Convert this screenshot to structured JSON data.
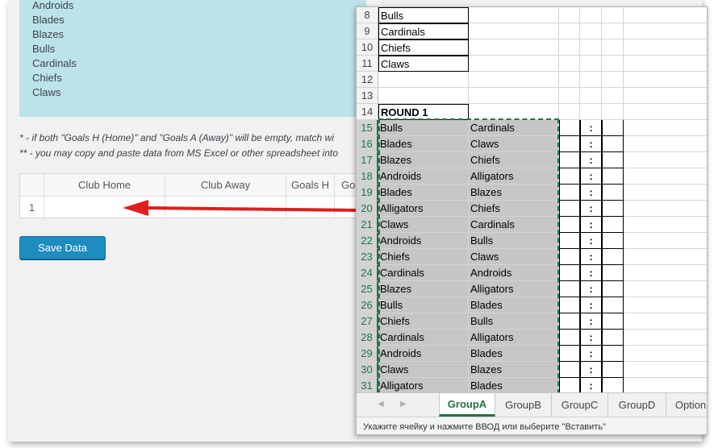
{
  "web_form": {
    "clubs": [
      "Androids",
      "Blades",
      "Blazes",
      "Bulls",
      "Cardinals",
      "Chiefs",
      "Claws"
    ],
    "notes": [
      "* - if both \"Goals H (Home)\" and \"Goals A (Away)\" will be empty, match wi",
      "** - you may copy and paste data from MS Excel or other spreadsheet into"
    ],
    "grid": {
      "headers": [
        "Club Home",
        "Club Away",
        "Goals H",
        "Goa"
      ],
      "row_numbers": [
        "1"
      ]
    },
    "save_label": "Save Data"
  },
  "spreadsheet": {
    "rows": [
      {
        "num": "8",
        "a": "Bulls",
        "b": ""
      },
      {
        "num": "9",
        "a": "Cardinals",
        "b": ""
      },
      {
        "num": "10",
        "a": "Chiefs",
        "b": ""
      },
      {
        "num": "11",
        "a": "Claws",
        "b": ""
      },
      {
        "num": "12",
        "a": "",
        "b": ""
      },
      {
        "num": "13",
        "a": "",
        "b": ""
      },
      {
        "num": "14",
        "a": "ROUND 1",
        "b": ""
      },
      {
        "num": "15",
        "a": "Bulls",
        "b": "Cardinals"
      },
      {
        "num": "16",
        "a": "Blades",
        "b": "Claws"
      },
      {
        "num": "17",
        "a": "Blazes",
        "b": "Chiefs"
      },
      {
        "num": "18",
        "a": "Androids",
        "b": "Alligators"
      },
      {
        "num": "19",
        "a": "Blades",
        "b": "Blazes"
      },
      {
        "num": "20",
        "a": "Alligators",
        "b": "Chiefs"
      },
      {
        "num": "21",
        "a": "Claws",
        "b": "Cardinals"
      },
      {
        "num": "22",
        "a": "Androids",
        "b": "Bulls"
      },
      {
        "num": "23",
        "a": "Chiefs",
        "b": "Claws"
      },
      {
        "num": "24",
        "a": "Cardinals",
        "b": "Androids"
      },
      {
        "num": "25",
        "a": "Blazes",
        "b": "Alligators"
      },
      {
        "num": "26",
        "a": "Bulls",
        "b": "Blades"
      },
      {
        "num": "27",
        "a": "Chiefs",
        "b": "Bulls"
      },
      {
        "num": "28",
        "a": "Cardinals",
        "b": "Alligators"
      },
      {
        "num": "29",
        "a": "Androids",
        "b": "Blades"
      },
      {
        "num": "30",
        "a": "Claws",
        "b": "Blazes"
      },
      {
        "num": "31",
        "a": "Alligators",
        "b": "Blades"
      }
    ],
    "score_separator": ":",
    "tabs": [
      "GroupA",
      "GroupB",
      "GroupC",
      "GroupD",
      "Option"
    ],
    "active_tab": "GroupA",
    "status_text": "Укажите ячейку и нажмите ВВОД или выберите \"Вставить\"",
    "accent_color": "#217346"
  }
}
